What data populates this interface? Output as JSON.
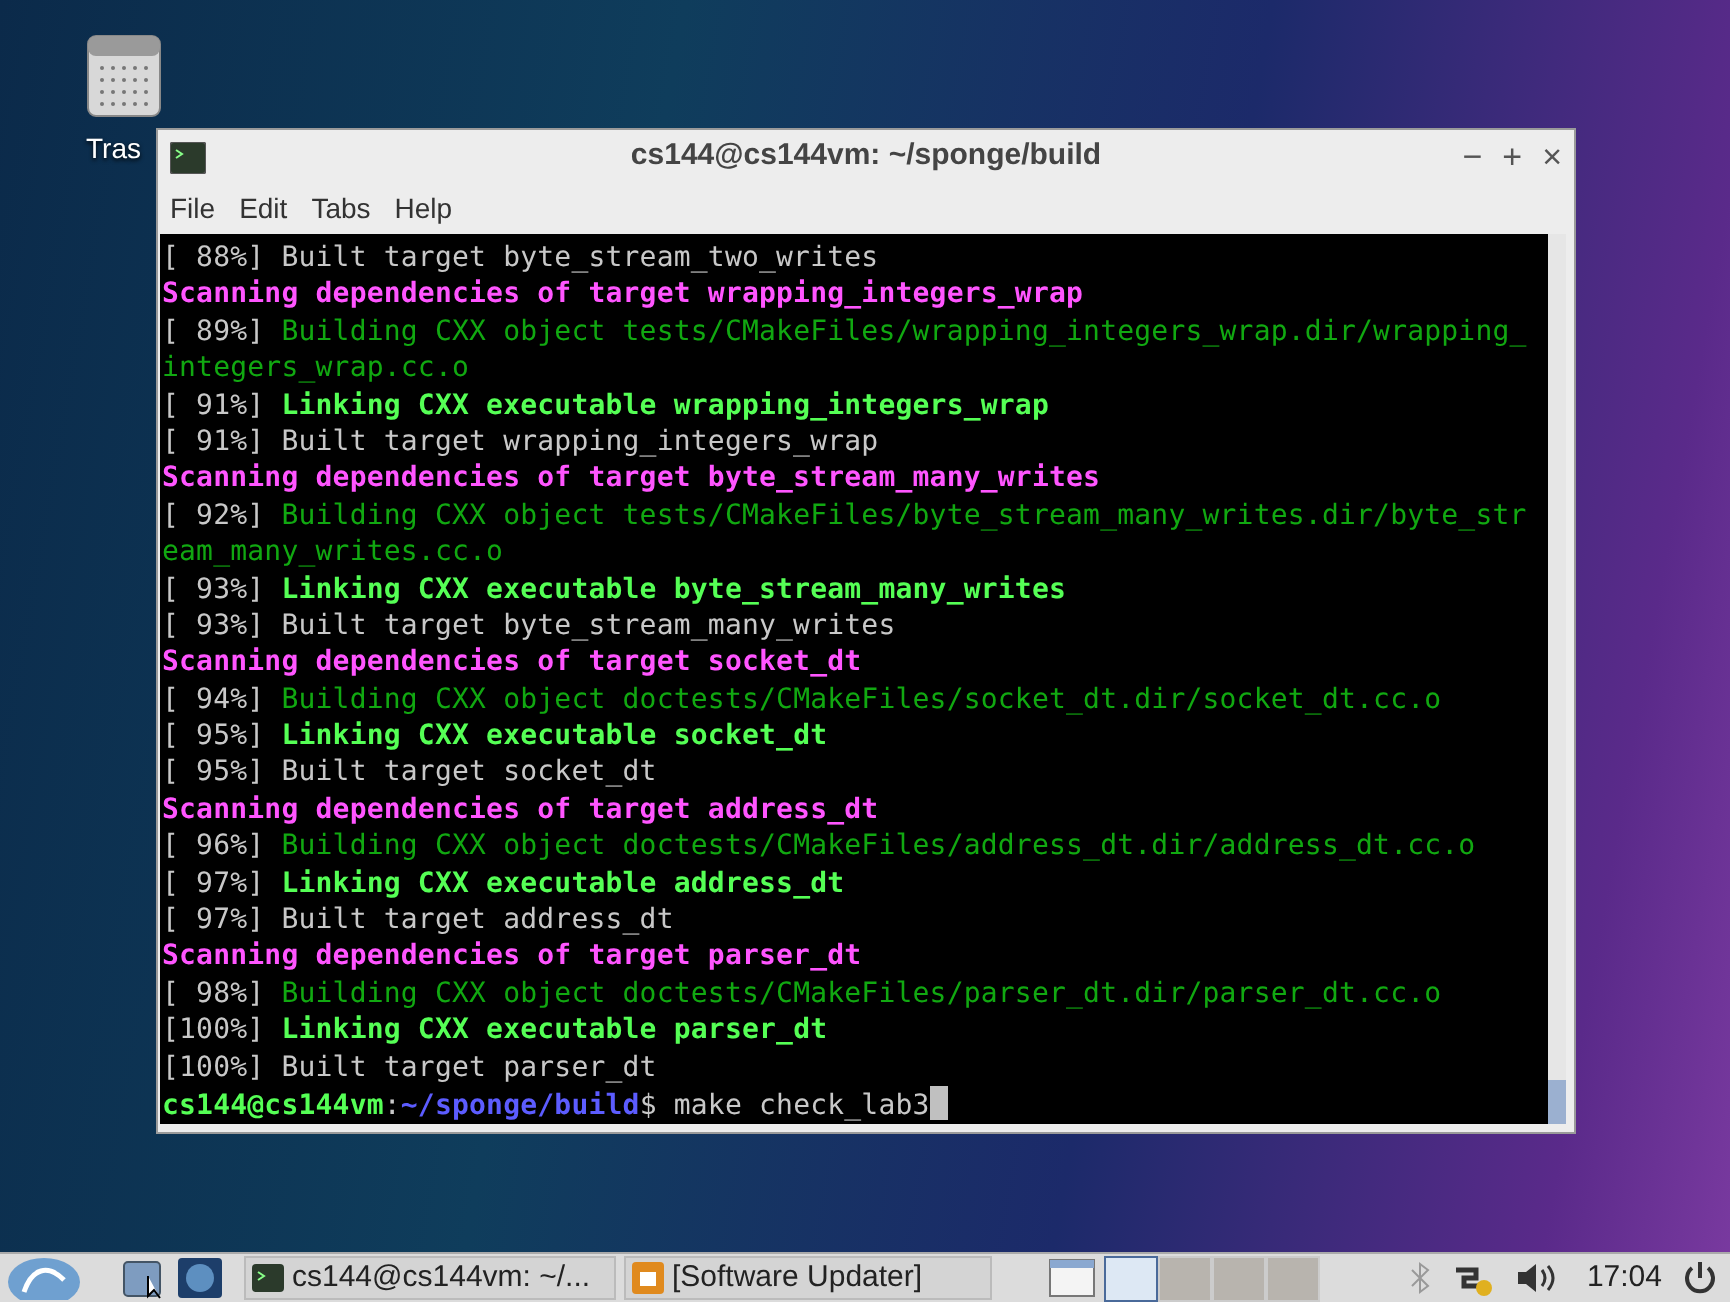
{
  "desktop": {
    "icons": [
      {
        "label": "Tras"
      }
    ]
  },
  "window": {
    "title": "cs144@cs144vm: ~/sponge/build",
    "controls": [
      "−",
      "+",
      "×"
    ],
    "menu": [
      "File",
      "Edit",
      "Tabs",
      "Help"
    ],
    "terminal": {
      "lines": [
        [
          {
            "kind": "plain",
            "text": "[ 88%] Built target byte_stream_two_writes"
          }
        ],
        [
          {
            "kind": "scan",
            "text": "Scanning dependencies of target wrapping_integers_wrap"
          }
        ],
        [
          {
            "kind": "plain",
            "text": "[ 89%] "
          },
          {
            "kind": "build",
            "text": "Building CXX object tests/CMakeFiles/wrapping_integers_wrap.dir/wrapping_"
          }
        ],
        [
          {
            "kind": "build",
            "text": "integers_wrap.cc.o"
          }
        ],
        [
          {
            "kind": "plain",
            "text": "[ 91%] "
          },
          {
            "kind": "link",
            "text": "Linking CXX executable wrapping_integers_wrap"
          }
        ],
        [
          {
            "kind": "plain",
            "text": "[ 91%] Built target wrapping_integers_wrap"
          }
        ],
        [
          {
            "kind": "scan",
            "text": "Scanning dependencies of target byte_stream_many_writes"
          }
        ],
        [
          {
            "kind": "plain",
            "text": "[ 92%] "
          },
          {
            "kind": "build",
            "text": "Building CXX object tests/CMakeFiles/byte_stream_many_writes.dir/byte_str"
          }
        ],
        [
          {
            "kind": "build",
            "text": "eam_many_writes.cc.o"
          }
        ],
        [
          {
            "kind": "plain",
            "text": "[ 93%] "
          },
          {
            "kind": "link",
            "text": "Linking CXX executable byte_stream_many_writes"
          }
        ],
        [
          {
            "kind": "plain",
            "text": "[ 93%] Built target byte_stream_many_writes"
          }
        ],
        [
          {
            "kind": "scan",
            "text": "Scanning dependencies of target socket_dt"
          }
        ],
        [
          {
            "kind": "plain",
            "text": "[ 94%] "
          },
          {
            "kind": "build",
            "text": "Building CXX object doctests/CMakeFiles/socket_dt.dir/socket_dt.cc.o"
          }
        ],
        [
          {
            "kind": "plain",
            "text": "[ 95%] "
          },
          {
            "kind": "link",
            "text": "Linking CXX executable socket_dt"
          }
        ],
        [
          {
            "kind": "plain",
            "text": "[ 95%] Built target socket_dt"
          }
        ],
        [
          {
            "kind": "scan",
            "text": "Scanning dependencies of target address_dt"
          }
        ],
        [
          {
            "kind": "plain",
            "text": "[ 96%] "
          },
          {
            "kind": "build",
            "text": "Building CXX object doctests/CMakeFiles/address_dt.dir/address_dt.cc.o"
          }
        ],
        [
          {
            "kind": "plain",
            "text": "[ 97%] "
          },
          {
            "kind": "link",
            "text": "Linking CXX executable address_dt"
          }
        ],
        [
          {
            "kind": "plain",
            "text": "[ 97%] Built target address_dt"
          }
        ],
        [
          {
            "kind": "scan",
            "text": "Scanning dependencies of target parser_dt"
          }
        ],
        [
          {
            "kind": "plain",
            "text": "[ 98%] "
          },
          {
            "kind": "build",
            "text": "Building CXX object doctests/CMakeFiles/parser_dt.dir/parser_dt.cc.o"
          }
        ],
        [
          {
            "kind": "plain",
            "text": "[100%] "
          },
          {
            "kind": "link",
            "text": "Linking CXX executable parser_dt"
          }
        ],
        [
          {
            "kind": "plain",
            "text": "[100%] Built target parser_dt"
          }
        ],
        [
          {
            "kind": "user",
            "text": "cs144@cs144vm"
          },
          {
            "kind": "plain",
            "text": ":"
          },
          {
            "kind": "path",
            "text": "~/sponge/build"
          },
          {
            "kind": "plain",
            "text": "$ make check_lab3"
          },
          {
            "kind": "cursor"
          }
        ]
      ]
    }
  },
  "taskbar": {
    "tasks": [
      {
        "kind": "terminal",
        "label": "cs144@cs144vm: ~/...",
        "selected": false
      },
      {
        "kind": "updater",
        "label": "[Software Updater]",
        "selected": false
      }
    ],
    "workspaces": [
      {
        "selected": true
      },
      {
        "selected": false
      },
      {
        "selected": false
      },
      {
        "selected": false
      }
    ],
    "clock": "17:04"
  }
}
